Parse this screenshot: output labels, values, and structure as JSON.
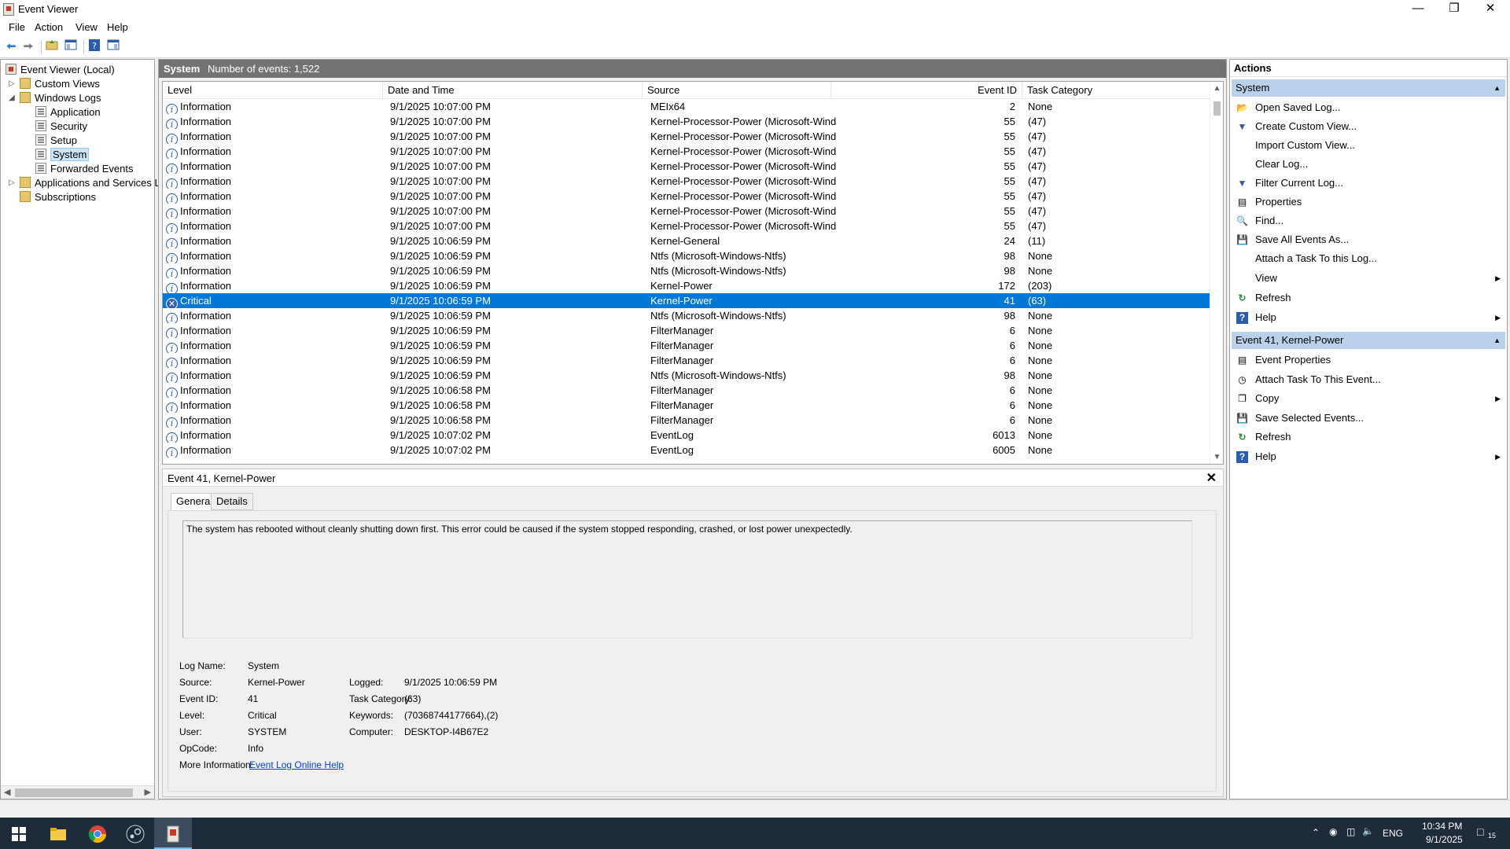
{
  "window": {
    "title": "Event Viewer"
  },
  "menu": [
    "File",
    "Action",
    "View",
    "Help"
  ],
  "tree": {
    "root": "Event Viewer (Local)",
    "custom_views": "Custom Views",
    "windows_logs": "Windows Logs",
    "logs": [
      "Application",
      "Security",
      "Setup",
      "System",
      "Forwarded Events"
    ],
    "apps_services": "Applications and Services Lo",
    "subscriptions": "Subscriptions"
  },
  "center": {
    "log_name": "System",
    "event_count": "Number of events: 1,522",
    "columns": [
      "Level",
      "Date and Time",
      "Source",
      "Event ID",
      "Task Category"
    ],
    "rows": [
      [
        "Information",
        "9/1/2025 10:07:00 PM",
        "MEIx64",
        "2",
        "None"
      ],
      [
        "Information",
        "9/1/2025 10:07:00 PM",
        "Kernel-Processor-Power (Microsoft-Wind...",
        "55",
        "(47)"
      ],
      [
        "Information",
        "9/1/2025 10:07:00 PM",
        "Kernel-Processor-Power (Microsoft-Wind...",
        "55",
        "(47)"
      ],
      [
        "Information",
        "9/1/2025 10:07:00 PM",
        "Kernel-Processor-Power (Microsoft-Wind...",
        "55",
        "(47)"
      ],
      [
        "Information",
        "9/1/2025 10:07:00 PM",
        "Kernel-Processor-Power (Microsoft-Wind...",
        "55",
        "(47)"
      ],
      [
        "Information",
        "9/1/2025 10:07:00 PM",
        "Kernel-Processor-Power (Microsoft-Wind...",
        "55",
        "(47)"
      ],
      [
        "Information",
        "9/1/2025 10:07:00 PM",
        "Kernel-Processor-Power (Microsoft-Wind...",
        "55",
        "(47)"
      ],
      [
        "Information",
        "9/1/2025 10:07:00 PM",
        "Kernel-Processor-Power (Microsoft-Wind...",
        "55",
        "(47)"
      ],
      [
        "Information",
        "9/1/2025 10:07:00 PM",
        "Kernel-Processor-Power (Microsoft-Wind...",
        "55",
        "(47)"
      ],
      [
        "Information",
        "9/1/2025 10:06:59 PM",
        "Kernel-General",
        "24",
        "(11)"
      ],
      [
        "Information",
        "9/1/2025 10:06:59 PM",
        "Ntfs (Microsoft-Windows-Ntfs)",
        "98",
        "None"
      ],
      [
        "Information",
        "9/1/2025 10:06:59 PM",
        "Ntfs (Microsoft-Windows-Ntfs)",
        "98",
        "None"
      ],
      [
        "Information",
        "9/1/2025 10:06:59 PM",
        "Kernel-Power",
        "172",
        "(203)"
      ],
      [
        "Critical",
        "9/1/2025 10:06:59 PM",
        "Kernel-Power",
        "41",
        "(63)"
      ],
      [
        "Information",
        "9/1/2025 10:06:59 PM",
        "Ntfs (Microsoft-Windows-Ntfs)",
        "98",
        "None"
      ],
      [
        "Information",
        "9/1/2025 10:06:59 PM",
        "FilterManager",
        "6",
        "None"
      ],
      [
        "Information",
        "9/1/2025 10:06:59 PM",
        "FilterManager",
        "6",
        "None"
      ],
      [
        "Information",
        "9/1/2025 10:06:59 PM",
        "FilterManager",
        "6",
        "None"
      ],
      [
        "Information",
        "9/1/2025 10:06:59 PM",
        "Ntfs (Microsoft-Windows-Ntfs)",
        "98",
        "None"
      ],
      [
        "Information",
        "9/1/2025 10:06:58 PM",
        "FilterManager",
        "6",
        "None"
      ],
      [
        "Information",
        "9/1/2025 10:06:58 PM",
        "FilterManager",
        "6",
        "None"
      ],
      [
        "Information",
        "9/1/2025 10:06:58 PM",
        "FilterManager",
        "6",
        "None"
      ],
      [
        "Information",
        "9/1/2025 10:07:02 PM",
        "EventLog",
        "6013",
        "None"
      ],
      [
        "Information",
        "9/1/2025 10:07:02 PM",
        "EventLog",
        "6005",
        "None"
      ]
    ],
    "selected_row": 13
  },
  "detail": {
    "title": "Event 41, Kernel-Power",
    "tabs": [
      "General",
      "Details"
    ],
    "description": "The system has rebooted without cleanly shutting down first. This error could be caused if the system stopped responding, crashed, or lost power unexpectedly.",
    "labels": {
      "log_name": "Log Name:",
      "source": "Source:",
      "event_id": "Event ID:",
      "level": "Level:",
      "user": "User:",
      "opcode": "OpCode:",
      "more_info": "More Information:",
      "logged": "Logged:",
      "task_category": "Task Category:",
      "keywords": "Keywords:",
      "computer": "Computer:"
    },
    "values": {
      "log_name": "System",
      "source": "Kernel-Power",
      "event_id": "41",
      "level": "Critical",
      "user": "SYSTEM",
      "opcode": "Info",
      "more_info": "Event Log Online Help",
      "logged": "9/1/2025 10:06:59 PM",
      "task_category": "(63)",
      "keywords": "(70368744177664),(2)",
      "computer": "DESKTOP-I4B67E2"
    }
  },
  "actions": {
    "header": "Actions",
    "group1": "System",
    "group1_items": [
      "Open Saved Log...",
      "Create Custom View...",
      "Import Custom View...",
      "Clear Log...",
      "Filter Current Log...",
      "Properties",
      "Find...",
      "Save All Events As...",
      "Attach a Task To this Log...",
      "View",
      "Refresh",
      "Help"
    ],
    "group2": "Event 41, Kernel-Power",
    "group2_items": [
      "Event Properties",
      "Attach Task To This Event...",
      "Copy",
      "Save Selected Events...",
      "Refresh",
      "Help"
    ]
  },
  "taskbar": {
    "lang": "ENG",
    "time": "10:34 PM",
    "date": "9/1/2025",
    "notifications": "15"
  },
  "colors": {
    "selection": "#0078d7",
    "header": "#737373",
    "action_group": "#b9d1ea",
    "taskbar": "#1d2b3a"
  }
}
